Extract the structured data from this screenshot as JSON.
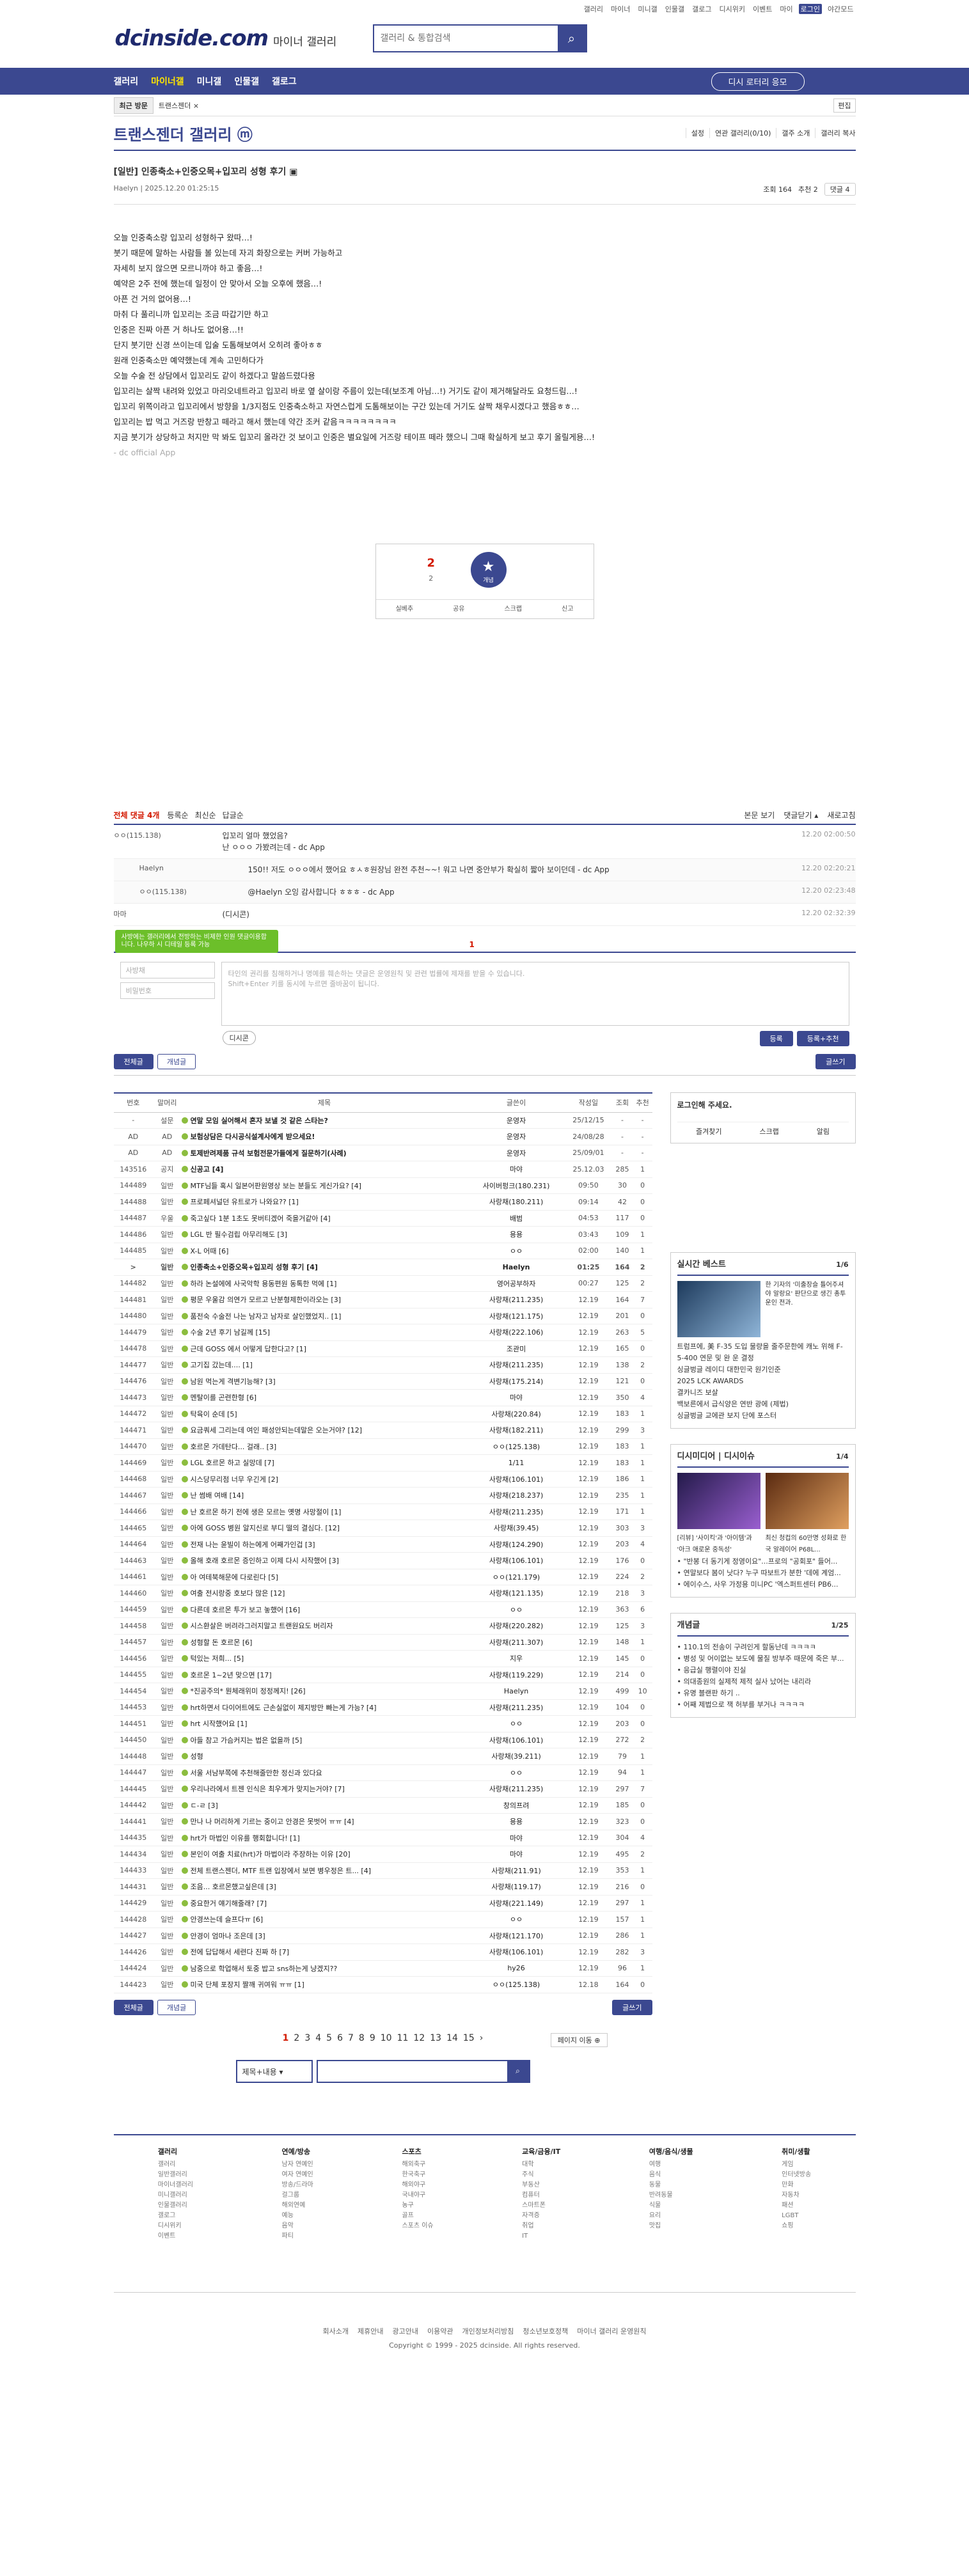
{
  "top_links": [
    "갤러리",
    "마이너",
    "미니갤",
    "인물갤",
    "갤로그",
    "디시위키",
    "이벤트",
    "마이",
    "로그인",
    "야간모드"
  ],
  "logo": "dcinside.com",
  "logo_sub": "마이너 갤러리",
  "search_placeholder": "갤러리 & 통합검색",
  "gnb": [
    "갤러리",
    "마이너갤",
    "미니갤",
    "인물갤",
    "갤로그"
  ],
  "gnb_active": "마이너갤",
  "download_btn": "디시 로터리 응모",
  "visit_label": "최근 방문",
  "visit_item": "트랜스젠더 ×",
  "visit_edit": "편집",
  "gallery_title": "트랜스젠더 갤러리 ⓜ",
  "gallery_opts": [
    "설정",
    "연관 갤러리(0/10)",
    "갤주 소개",
    "갤러리 복사"
  ],
  "post": {
    "title": "[일반] 인종축소+인중오목+입꼬리 성형 후기 ▣",
    "author": "Haelyn",
    "date": "2025.12.20 01:25:15",
    "views": "조회 164",
    "recommend": "추천 2",
    "comments": "댓글 4",
    "lines": [
      "오늘 인중축소랑 입꼬리 성형하구 왔따…!",
      "붓기 때문에 말하는 사람들 볼 있는데 자괴 화장으로는 커버 가능하고",
      "자세히 보지 않으면 모르니까야 하고 좋음…!",
      "예약은 2주 전에 했는데 일정이 안 맞아서 오늘 오후에 했음…!",
      "아픈 건 거의 없어용…!",
      "마취 다 풀리니까 입꼬리는 조금 따갑기만 하고",
      "인중은 진짜 아픈 거 하나도 없어용…!!",
      "단지 붓기만 신경 쓰이는데 입술 도톰해보여서 오히려 좋아ㅎㅎ",
      "원래 인중축소만 예약했는데 계속 고민하다가",
      "오늘 수술 전 상담에서 입꼬리도 같이 하겠다고 말씀드렸다용",
      "입꼬리는 살짝 내려와 있었고 마리오네트라고 입꼬리 바로 옆 살이랑 주름이 있는데(보조계 아님…!) 거기도 같이 제거해달라도 요청드림…!",
      "입꼬리 위쪽이라고 입꼬리에서 방향을 1/3지점도 인중축소하고 자연스럽게 도톰해보이는 구간 있는데 거기도 살짝 채우시겠다고 했음ㅎㅎ…",
      "입꼬리는 밥 먹고 거즈랑 반창고 떼라고 해서 했는데 약간 조커 같음ㅋㅋㅋㅋㅋㅋㅋㅋ",
      "지금 붓기가 상당하고 처지만 막 봐도 입꼬리 올라간 것 보이고 인중은 별요일에 거즈랑 테이프 떼라 했으니 그때 확실하게 보고 후기 올릴게용…!"
    ],
    "source": "- dc official App"
  },
  "rec": {
    "up": "2",
    "up_sub": "2",
    "star_label": "개념",
    "bar": [
      "실베추",
      "공유",
      "스크랩",
      "신고"
    ]
  },
  "cmt_head": {
    "total": "전체 댓글 4개",
    "opts": [
      "등록순",
      "최신순",
      "답글순"
    ],
    "right": [
      "본문 보기",
      "댓글닫기 ▴",
      "새로고침"
    ]
  },
  "comments": [
    {
      "nick": "ㅇㅇ(115.138)",
      "text": "입꼬리 얼마 했었음?\n난 ㅇㅇㅇ 가봤려는데 - dc App",
      "date": "12.20 02:00:50",
      "reply": false
    },
    {
      "nick": "Haelyn",
      "text": "150!! 저도 ㅇㅇㅇ에서 했어요 ㅎㅅㅎ원장님 완전 추천~~! 워고 나면 중안부가 확실히 짧아 보이던데 - dc App",
      "date": "12.20 02:20:21",
      "reply": true
    },
    {
      "nick": "ㅇㅇ(115.138)",
      "text": "@Haelyn 오잉 감사합니다 ㅎㅎㅎ - dc App",
      "date": "12.20 02:23:48",
      "reply": true
    },
    {
      "nick": "마마",
      "text": "(디시콘)",
      "date": "12.20 02:32:39",
      "reply": false
    }
  ],
  "write": {
    "tip": "사방에는 갤러리에서 전방하는 비제한 인원 댓글이용합니다. 나우하 시 디테일 등록 가능",
    "pgc": "1",
    "nick_placeholder": "사방채",
    "pw_placeholder": "비밀번호",
    "ta_placeholder": "타인의 권리를 침해하거나 명예를 훼손하는 댓글은 운영원칙 및 관련 법률에 제재를 받을 수 있습니다.\nShift+Enter 키를 동시에 누르면 줄바꿈이 됩니다.",
    "dccon": "디시콘",
    "submit": [
      "등록",
      "등록+추천"
    ]
  },
  "list_tabs": [
    "전체글",
    "개념글"
  ],
  "write_btn": "글쓰기",
  "table_head": [
    "번호",
    "말머리",
    "제목",
    "글쓴이",
    "작성일",
    "조회",
    "추천"
  ],
  "rows": [
    [
      "-",
      "설문",
      "연말 모임 실어해서 혼자 보낼 것 같은 스타는?",
      "운영자",
      "25/12/15",
      "-",
      "-",
      "n"
    ],
    [
      "AD",
      "AD",
      "보험상담은 다시공식설계사에게 받으세요!",
      "운영자",
      "24/08/28",
      "-",
      "-",
      "n"
    ],
    [
      "AD",
      "AD",
      "토제반려제품 규석 보험전문가들에게 질문하기(사례)",
      "운영자",
      "25/09/01",
      "-",
      "-",
      "n"
    ],
    [
      "143516",
      "공지",
      "신공고 [4]",
      "마야",
      "25.12.03",
      "285",
      "1",
      "n"
    ],
    [
      "144489",
      "일반",
      "MTF님들 혹시 일본어판원영상 보는 분들도 게신가요? [4]",
      "사이버펑크(180.231)",
      "09:50",
      "30",
      "0",
      ""
    ],
    [
      "144488",
      "일반",
      "프로페셔널던 유트로가 나와요?? [1]",
      "사랑채(180.211)",
      "09:14",
      "42",
      "0",
      ""
    ],
    [
      "144487",
      "우울",
      "죽고싶다 1분 1초도 못버티겠어 죽을거같아 [4]",
      "배범",
      "04:53",
      "117",
      "0",
      ""
    ],
    [
      "144486",
      "일반",
      "LGL 반 필수검립 아무리해도 [3]",
      "용용",
      "03:43",
      "109",
      "1",
      ""
    ],
    [
      "144485",
      "일반",
      "X-L 어때 [6]",
      "ㅇㅇ",
      "02:00",
      "140",
      "1",
      ""
    ],
    [
      ">",
      "일반",
      "인종축소+인중오목+입꼬리 성형 후기 [4]",
      "Haelyn",
      "01:25",
      "164",
      "2",
      "c"
    ],
    [
      "144482",
      "일반",
      "하라 논설에에 사국악학 용동편원 동톡한 먹에 [1]",
      "영어공부하자",
      "00:27",
      "125",
      "2",
      ""
    ],
    [
      "144481",
      "일반",
      "평문 우울감 의연가 모르고 난분형제한이라오는 [3]",
      "사랑채(211.235)",
      "12.19",
      "164",
      "7",
      ""
    ],
    [
      "144480",
      "일반",
      "품전숙 수술전 나는 남자고 남자로 살인했었지.. [1]",
      "사랑채(121.175)",
      "12.19",
      "201",
      "0",
      ""
    ],
    [
      "144479",
      "일반",
      "수술 2년 후기 남길께 [15]",
      "사랑채(222.106)",
      "12.19",
      "263",
      "5",
      ""
    ],
    [
      "144478",
      "일반",
      "근데 GOSS 에서 어떻게 답한다고? [1]",
      "조관미",
      "12.19",
      "165",
      "0",
      ""
    ],
    [
      "144477",
      "일반",
      "고기집 갔는데.... [1]",
      "사랑채(211.235)",
      "12.19",
      "138",
      "2",
      ""
    ],
    [
      "144476",
      "일반",
      "남원 먹는게 격변기능해? [3]",
      "사랑채(175.214)",
      "12.19",
      "121",
      "0",
      ""
    ],
    [
      "144473",
      "일반",
      "멘탈이를 곤련한형 [6]",
      "마야",
      "12.19",
      "350",
      "4",
      ""
    ],
    [
      "144472",
      "일반",
      "탁육이 순데 [5]",
      "사랑채(220.84)",
      "12.19",
      "183",
      "1",
      ""
    ],
    [
      "144471",
      "일반",
      "요금쿼세 그리는데 여인 패성안되는데말은 오는거야? [12]",
      "사랑채(182.211)",
      "12.19",
      "299",
      "3",
      ""
    ],
    [
      "144470",
      "일반",
      "호르몬 가데탄다... 걸래.. [3]",
      "ㅇㅇ(125.138)",
      "12.19",
      "183",
      "1",
      ""
    ],
    [
      "144469",
      "일반",
      "LGL 호르몬 하고 실망데 [7]",
      "1/11",
      "12.19",
      "183",
      "1",
      ""
    ],
    [
      "144468",
      "일반",
      "시스당무리점 너무 우긴게 [2]",
      "사랑채(106.101)",
      "12.19",
      "186",
      "1",
      ""
    ],
    [
      "144467",
      "일반",
      "난 썸배 여배 [14]",
      "사랑채(218.237)",
      "12.19",
      "235",
      "1",
      ""
    ],
    [
      "144466",
      "일반",
      "난 호르몬 하기 전에 생은 모르는 옛명 사망절이 [1]",
      "사랑채(211.235)",
      "12.19",
      "171",
      "1",
      ""
    ],
    [
      "144465",
      "일반",
      "아에 GOSS 병원 알지신로 부디 떨의 결심다. [12]",
      "사랑채(39.45)",
      "12.19",
      "303",
      "3",
      ""
    ],
    [
      "144464",
      "일반",
      "전재 나는 윤빌이 하는에게 어째가인겁 [3]",
      "사랑채(124.290)",
      "12.19",
      "203",
      "4",
      ""
    ],
    [
      "144463",
      "일반",
      "올해 호래 호르몬 증인하고 이제 다시 시작했어 [3]",
      "사랑채(106.101)",
      "12.19",
      "176",
      "0",
      ""
    ],
    [
      "144461",
      "일반",
      "아 여테북해문에 다로린다 [5]",
      "ㅇㅇ(121.179)",
      "12.19",
      "224",
      "2",
      ""
    ],
    [
      "144460",
      "일반",
      "여출 전시랑중 호보다 많은 [12]",
      "사랑채(121.135)",
      "12.19",
      "218",
      "3",
      ""
    ],
    [
      "144459",
      "일반",
      "다른데 호르몬 투가 보고 놓했어 [16]",
      "ㅇㅇ",
      "12.19",
      "363",
      "6",
      ""
    ],
    [
      "144458",
      "일반",
      "시스환살은 버려라그러지말고 트랜원요도 버리자",
      "사랑채(220.282)",
      "12.19",
      "125",
      "3",
      ""
    ],
    [
      "144457",
      "일반",
      "성형할 돈 호르몬 [6]",
      "사랑채(211.307)",
      "12.19",
      "148",
      "1",
      ""
    ],
    [
      "144456",
      "일반",
      "턱있는 저희... [5]",
      "지우",
      "12.19",
      "145",
      "0",
      ""
    ],
    [
      "144455",
      "일반",
      "호르몬 1~2년 맞으면 [17]",
      "사랑채(119.229)",
      "12.19",
      "214",
      "0",
      ""
    ],
    [
      "144454",
      "일반",
      "*진공주의* 뭔체래위미 정정께지! [26]",
      "Haelyn",
      "12.19",
      "499",
      "10",
      ""
    ],
    [
      "144453",
      "일반",
      "hrt하면서 다이어트에도 근손실없이 제지방만 빠는게 가능? [4]",
      "사랑채(211.235)",
      "12.19",
      "104",
      "0",
      ""
    ],
    [
      "144451",
      "일반",
      "hrt 시작했어요 [1]",
      "ㅇㅇ",
      "12.19",
      "203",
      "0",
      ""
    ],
    [
      "144450",
      "일반",
      "아들 참고 가슴커지는 법은 없을까 [5]",
      "사랑채(106.101)",
      "12.19",
      "272",
      "2",
      ""
    ],
    [
      "144448",
      "일반",
      "성형",
      "사랑채(39.211)",
      "12.19",
      "79",
      "1",
      ""
    ],
    [
      "144447",
      "일반",
      "서울 서남부쪽에 추천해줄만한 정신과 있다요",
      "ㅇㅇ",
      "12.19",
      "94",
      "1",
      ""
    ],
    [
      "144445",
      "일반",
      "우리나라에서 트젠 인식은 최우계가 맞지는거야? [7]",
      "사랑채(211.235)",
      "12.19",
      "297",
      "7",
      ""
    ],
    [
      "144442",
      "일반",
      "ㄷ-ㄹ [3]",
      "창의프려",
      "12.19",
      "185",
      "0",
      ""
    ],
    [
      "144441",
      "일반",
      "만나 나 머리하게 기르는 중이고 안경은 못벗어 ㅠㅠ [4]",
      "용용",
      "12.19",
      "323",
      "0",
      ""
    ],
    [
      "144435",
      "일반",
      "hrt가 마법인 이유를 행회합니다! [1]",
      "마야",
      "12.19",
      "304",
      "4",
      ""
    ],
    [
      "144434",
      "일반",
      "본인이 여출 치료(hrt)가 마법이라 주장하는 이유 [20]",
      "마야",
      "12.19",
      "495",
      "2",
      ""
    ],
    [
      "144433",
      "일반",
      "전체 트랜스젠더, MTF 트랜 입장에서 보면 병우정은 트... [4]",
      "사랑채(211.91)",
      "12.19",
      "353",
      "1",
      ""
    ],
    [
      "144431",
      "일반",
      "조음... 호르몬했고싶은데 [3]",
      "사랑채(119.17)",
      "12.19",
      "216",
      "0",
      ""
    ],
    [
      "144429",
      "일반",
      "중요한거 얘기해줄래? [7]",
      "사랑채(221.149)",
      "12.19",
      "297",
      "1",
      ""
    ],
    [
      "144428",
      "일반",
      "안경쓰는데 슬프다ㅠ [6]",
      "ㅇㅇ",
      "12.19",
      "157",
      "1",
      ""
    ],
    [
      "144427",
      "일반",
      "안경이 엄마나 조은데 [3]",
      "사랑채(121.170)",
      "12.19",
      "286",
      "1",
      ""
    ],
    [
      "144426",
      "일반",
      "전에 답답해서 세련다 진짜 하 [7]",
      "사랑채(106.101)",
      "12.19",
      "282",
      "3",
      ""
    ],
    [
      "144424",
      "일반",
      "남중으로 학업해서 토중 밥고 sns하는게 냥겠지??",
      "hy26",
      "12.19",
      "96",
      "1",
      ""
    ],
    [
      "144423",
      "일반",
      "미국 단체 포장지 짤깨 귀여워 ㅠㅠ [1]",
      "ㅇㅇ(125.138)",
      "12.18",
      "164",
      "0",
      ""
    ]
  ],
  "side": {
    "login": "로그인해 주세요.",
    "login_links": [
      "즐겨찾기",
      "스크랩",
      "알림"
    ],
    "best_title": "실시간 베스트",
    "best_pg": "1/6",
    "best_cap": "한 기자의 '미출장슬 틀어주셔야 알랑요' 판단으로 생긴 총투운인 전과.",
    "best_items": [
      "트럼프에, 美 F-35 도입 물량을 줄주문한에 캐노 위해 F-5-400 연문 및 완 운 결정",
      "싱글벙글 레이디 대한민국 원기인준",
      "2025 LCK AWARDS",
      "결카니즈 보살",
      "백보른에서 급식양은 연반 광에 (제법)",
      "싱글벙글 교에관 보지 단에 포스터"
    ],
    "dcc_title": "디시미디어",
    "dcc_sub": "디시이슈",
    "dcc_pg": "1/4",
    "dcc_caps": [
      "[리뷰] '사이킥'과 '아이템'과 '아크 애로운 중독성'",
      "최신 청컵의 60만명 성화로 한국 알레이어 P68L..."
    ],
    "dcc_items": [
      "\"반봉 더 동기게 정영이요\"...프로의 \"공회포\" 들어...",
      "연말보다 봄이 낫다? 누구 따보트가 분한 '데에 계엄...",
      "에이수스, 사우 가정용 미니PC '엑스퍼트센터 PB6..."
    ],
    "gaenyeom_title": "개념글",
    "gaenyeom_pg": "1/25",
    "gaenyeom_items": [
      "110.1의 전송이 구려인게 할동난데 ㅋㅋㅋㅋ",
      "병성 및 어이없는 보도에 물질 방부주 때문에 죽은 부...",
      "응급실 행렬이야 진실",
      "의대종원의 실제적 제적 실사 났어는 내리라",
      "유명 블랜판 하기 ..",
      "어째 제법으로 잭 허부를 부거나 ㅋㅋㅋㅋ"
    ]
  },
  "pager": [
    "1",
    "2",
    "3",
    "4",
    "5",
    "6",
    "7",
    "8",
    "9",
    "10",
    "11",
    "12",
    "13",
    "14",
    "15"
  ],
  "pager_next": "›",
  "pager_jump": "페이지 이동 ⊕",
  "bsearch_sel": "제목+내용",
  "footer_cols": [
    {
      "title": "갤러리",
      "items": [
        "갤러리",
        "일반갤러리",
        "마이너갤러리",
        "미니갤러리",
        "인물갤러리",
        "갤로그",
        "디시위키",
        "이벤트"
      ]
    },
    {
      "title": "연예/방송",
      "items": [
        "남자 연예인",
        "여자 연예인",
        "방송/드라마",
        "걸그룹",
        "해외연예",
        "예능",
        "음악",
        "파티"
      ]
    },
    {
      "title": "스포츠",
      "items": [
        "해외축구",
        "한국축구",
        "해외야구",
        "국내야구",
        "농구",
        "골프",
        "스포츠 이슈"
      ]
    },
    {
      "title": "교육/금융/IT",
      "items": [
        "대학",
        "주식",
        "부동산",
        "컴퓨터",
        "스마트폰",
        "자격증",
        "취업",
        "IT"
      ]
    },
    {
      "title": "여행/음식/생물",
      "items": [
        "여행",
        "음식",
        "동물",
        "반려동물",
        "식물",
        "요리",
        "맛집"
      ]
    },
    {
      "title": "취미/생활",
      "items": [
        "게임",
        "인터넷방송",
        "만화",
        "자동차",
        "패션",
        "LGBT",
        "쇼핑"
      ]
    }
  ],
  "footer_bottom": [
    "회사소개",
    "제휴안내",
    "광고안내",
    "이용약관",
    "개인정보처리방침",
    "청소년보호정책",
    "마이너 갤러리 운영원칙"
  ],
  "copyright": "Copyright © 1999 - 2025 dcinside. All rights reserved."
}
